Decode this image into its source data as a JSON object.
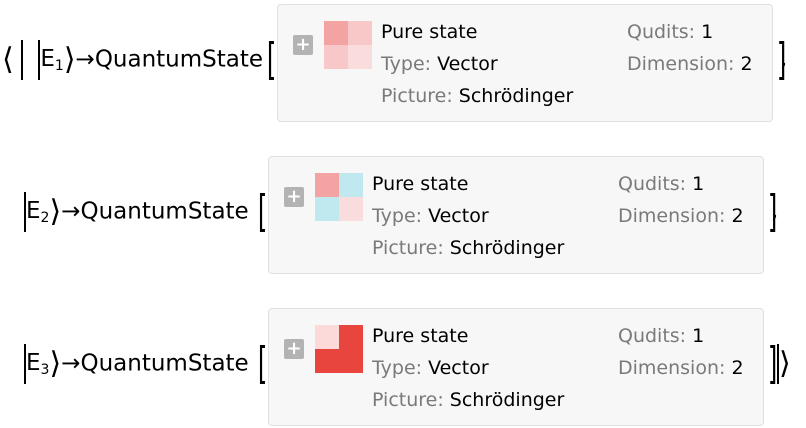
{
  "rows": [
    {
      "prefix_angle": "⟨",
      "ket_label": "E",
      "ket_sub": "1",
      "arrow": "→",
      "func": "QuantumState",
      "trailing": ",",
      "panel": {
        "title": "Pure state",
        "type_key": "Type:",
        "type_val": "Vector",
        "picture_key": "Picture:",
        "picture_val": "Schrödinger",
        "qudits_key": "Qudits:",
        "qudits_val": "1",
        "dim_key": "Dimension:",
        "dim_val": "2",
        "matrix_colors": [
          "#f4a3a3",
          "#f8c8c8",
          "#f8c8c8",
          "#fbdcdc"
        ]
      }
    },
    {
      "prefix_angle": "",
      "ket_label": "E",
      "ket_sub": "2",
      "arrow": "→",
      "func": "QuantumState",
      "trailing": ",",
      "panel": {
        "title": "Pure state",
        "type_key": "Type:",
        "type_val": "Vector",
        "picture_key": "Picture:",
        "picture_val": "Schrödinger",
        "qudits_key": "Qudits:",
        "qudits_val": "1",
        "dim_key": "Dimension:",
        "dim_val": "2",
        "matrix_colors": [
          "#f4a3a3",
          "#bfe9ee",
          "#bfe9ee",
          "#fbdcdc"
        ]
      }
    },
    {
      "prefix_angle": "",
      "ket_label": "E",
      "ket_sub": "3",
      "arrow": "→",
      "func": "QuantumState",
      "trailing": "⟩",
      "panel": {
        "title": "Pure state",
        "type_key": "Type:",
        "type_val": "Vector",
        "picture_key": "Picture:",
        "picture_val": "Schrödinger",
        "qudits_key": "Qudits:",
        "qudits_val": "1",
        "dim_key": "Dimension:",
        "dim_val": "2",
        "matrix_colors": [
          "#fcdada",
          "#e8453e",
          "#e8453e",
          "#e8453e"
        ]
      }
    }
  ],
  "icons": {
    "expand": "plus-icon"
  }
}
